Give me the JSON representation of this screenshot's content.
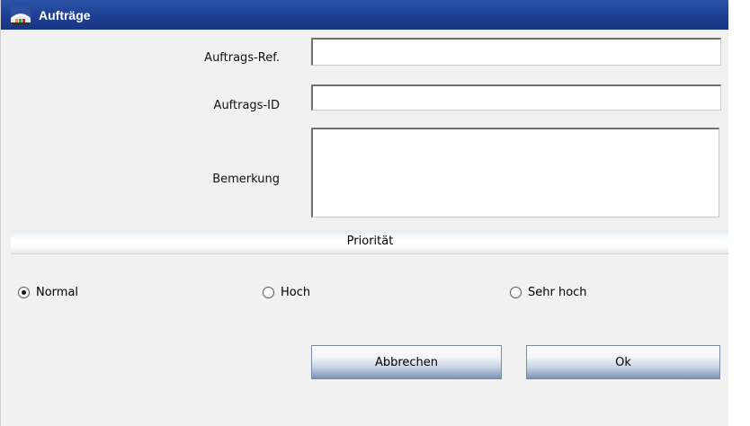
{
  "window": {
    "title": "Aufträge",
    "title_icon": "app-icon"
  },
  "form": {
    "ref_label": "Auftrags-Ref.",
    "ref_value": "",
    "id_label": "Auftrags-ID",
    "id_value": "",
    "remark_label": "Bemerkung",
    "remark_value": ""
  },
  "priority": {
    "section_title": "Priorität",
    "options": [
      {
        "label": "Normal",
        "selected": true
      },
      {
        "label": "Hoch",
        "selected": false
      },
      {
        "label": "Sehr hoch",
        "selected": false
      }
    ]
  },
  "buttons": {
    "cancel_label": "Abbrechen",
    "ok_label": "Ok"
  },
  "colors": {
    "titlebar": "#1d3f91",
    "background": "#f1f1f1",
    "button_dark": "#7c93b6"
  }
}
